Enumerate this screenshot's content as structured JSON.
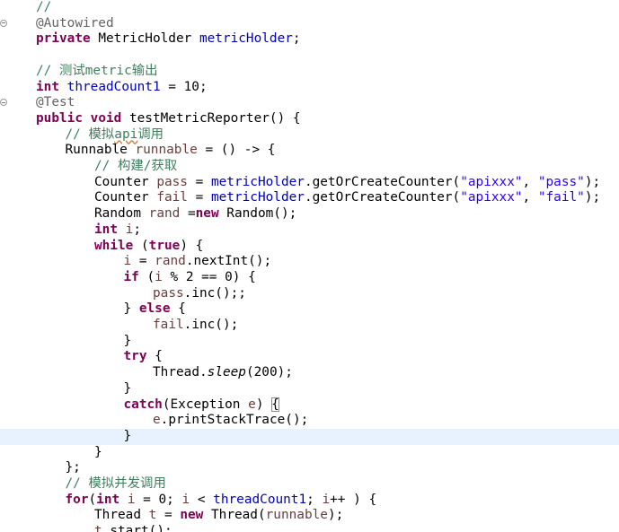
{
  "editor": {
    "lines": [
      {
        "indent": 0,
        "fold": false,
        "tokens": [
          {
            "t": "//",
            "k": "cm"
          }
        ]
      },
      {
        "indent": 0,
        "fold": true,
        "tokens": [
          {
            "t": "@Autowired",
            "k": "an"
          }
        ]
      },
      {
        "indent": 0,
        "fold": false,
        "tokens": [
          {
            "t": "private",
            "k": "kw"
          },
          {
            "t": " MetricHolder ",
            "k": "tx"
          },
          {
            "t": "metricHolder",
            "k": "fd"
          },
          {
            "t": ";",
            "k": "tx"
          }
        ]
      },
      {
        "indent": 0,
        "fold": false,
        "tokens": []
      },
      {
        "indent": 0,
        "fold": false,
        "tokens": [
          {
            "t": "// 测试metric输出",
            "k": "cm"
          }
        ]
      },
      {
        "indent": 0,
        "fold": false,
        "tokens": [
          {
            "t": "int",
            "k": "kw"
          },
          {
            "t": " ",
            "k": "tx"
          },
          {
            "t": "threadCount1",
            "k": "fd"
          },
          {
            "t": " = 10;",
            "k": "tx"
          }
        ]
      },
      {
        "indent": 0,
        "fold": true,
        "tokens": [
          {
            "t": "@Test",
            "k": "an"
          }
        ]
      },
      {
        "indent": 0,
        "fold": false,
        "tokens": [
          {
            "t": "public",
            "k": "kw"
          },
          {
            "t": " ",
            "k": "tx"
          },
          {
            "t": "void",
            "k": "kw"
          },
          {
            "t": " testMetricReporter() {",
            "k": "tx"
          }
        ]
      },
      {
        "indent": 1,
        "fold": false,
        "tokens": [
          {
            "t": "// 模拟",
            "k": "cm"
          },
          {
            "t": "api",
            "k": "cm",
            "sq": true
          },
          {
            "t": "调用",
            "k": "cm"
          }
        ]
      },
      {
        "indent": 1,
        "fold": false,
        "tokens": [
          {
            "t": "Runnable ",
            "k": "tx"
          },
          {
            "t": "runnable",
            "k": "lv"
          },
          {
            "t": " = () -> {",
            "k": "tx"
          }
        ]
      },
      {
        "indent": 2,
        "fold": false,
        "tokens": [
          {
            "t": "// 构建/获取",
            "k": "cm"
          }
        ]
      },
      {
        "indent": 2,
        "fold": false,
        "tokens": [
          {
            "t": "Counter ",
            "k": "tx"
          },
          {
            "t": "pass",
            "k": "lv"
          },
          {
            "t": " = ",
            "k": "tx"
          },
          {
            "t": "metricHolder",
            "k": "fd"
          },
          {
            "t": ".getOrCreateCounter(",
            "k": "tx"
          },
          {
            "t": "\"apixxx\"",
            "k": "st"
          },
          {
            "t": ", ",
            "k": "tx"
          },
          {
            "t": "\"pass\"",
            "k": "st"
          },
          {
            "t": ");",
            "k": "tx"
          }
        ]
      },
      {
        "indent": 2,
        "fold": false,
        "tokens": [
          {
            "t": "Counter ",
            "k": "tx"
          },
          {
            "t": "fail",
            "k": "lv"
          },
          {
            "t": " = ",
            "k": "tx"
          },
          {
            "t": "metricHolder",
            "k": "fd"
          },
          {
            "t": ".getOrCreateCounter(",
            "k": "tx"
          },
          {
            "t": "\"apixxx\"",
            "k": "st"
          },
          {
            "t": ", ",
            "k": "tx"
          },
          {
            "t": "\"fail\"",
            "k": "st"
          },
          {
            "t": ");",
            "k": "tx"
          }
        ]
      },
      {
        "indent": 2,
        "fold": false,
        "tokens": [
          {
            "t": "Random ",
            "k": "tx"
          },
          {
            "t": "rand",
            "k": "lv"
          },
          {
            "t": " =",
            "k": "tx"
          },
          {
            "t": "new",
            "k": "kw"
          },
          {
            "t": " Random();",
            "k": "tx"
          }
        ]
      },
      {
        "indent": 2,
        "fold": false,
        "tokens": [
          {
            "t": "int",
            "k": "kw"
          },
          {
            "t": " ",
            "k": "tx"
          },
          {
            "t": "i",
            "k": "lv"
          },
          {
            "t": ";",
            "k": "tx"
          }
        ]
      },
      {
        "indent": 2,
        "fold": false,
        "tokens": [
          {
            "t": "while",
            "k": "kw"
          },
          {
            "t": " (",
            "k": "tx"
          },
          {
            "t": "true",
            "k": "kw"
          },
          {
            "t": ") {",
            "k": "tx"
          }
        ]
      },
      {
        "indent": 3,
        "fold": false,
        "tokens": [
          {
            "t": "i",
            "k": "lv"
          },
          {
            "t": " = ",
            "k": "tx"
          },
          {
            "t": "rand",
            "k": "lv"
          },
          {
            "t": ".nextInt();",
            "k": "tx"
          }
        ]
      },
      {
        "indent": 3,
        "fold": false,
        "tokens": [
          {
            "t": "if",
            "k": "kw"
          },
          {
            "t": " (",
            "k": "tx"
          },
          {
            "t": "i",
            "k": "lv"
          },
          {
            "t": " % 2 == 0) {",
            "k": "tx"
          }
        ]
      },
      {
        "indent": 4,
        "fold": false,
        "tokens": [
          {
            "t": "pass",
            "k": "lv"
          },
          {
            "t": ".inc();;",
            "k": "tx"
          }
        ]
      },
      {
        "indent": 3,
        "fold": false,
        "tokens": [
          {
            "t": "} ",
            "k": "tx"
          },
          {
            "t": "else",
            "k": "kw"
          },
          {
            "t": " {",
            "k": "tx"
          }
        ]
      },
      {
        "indent": 4,
        "fold": false,
        "tokens": [
          {
            "t": "fail",
            "k": "lv"
          },
          {
            "t": ".inc();",
            "k": "tx"
          }
        ]
      },
      {
        "indent": 3,
        "fold": false,
        "tokens": [
          {
            "t": "}",
            "k": "tx"
          }
        ]
      },
      {
        "indent": 3,
        "fold": false,
        "tokens": [
          {
            "t": "try",
            "k": "kw"
          },
          {
            "t": " {",
            "k": "tx"
          }
        ]
      },
      {
        "indent": 4,
        "fold": false,
        "tokens": [
          {
            "t": "Thread.",
            "k": "tx"
          },
          {
            "t": "sleep",
            "k": "it"
          },
          {
            "t": "(200);",
            "k": "tx"
          }
        ]
      },
      {
        "indent": 3,
        "fold": false,
        "tokens": [
          {
            "t": "}",
            "k": "tx"
          }
        ]
      },
      {
        "indent": 3,
        "fold": false,
        "tokens": [
          {
            "t": "catch",
            "k": "kw"
          },
          {
            "t": "(Exception ",
            "k": "tx"
          },
          {
            "t": "e",
            "k": "lv"
          },
          {
            "t": ") ",
            "k": "tx"
          },
          {
            "t": "{",
            "k": "tx",
            "box": true
          }
        ]
      },
      {
        "indent": 4,
        "fold": false,
        "tokens": [
          {
            "t": "e",
            "k": "lv"
          },
          {
            "t": ".printStackTrace();",
            "k": "tx"
          }
        ]
      },
      {
        "indent": 3,
        "fold": false,
        "current": true,
        "tokens": [
          {
            "t": "}",
            "k": "tx"
          }
        ]
      },
      {
        "indent": 2,
        "fold": false,
        "tokens": [
          {
            "t": "}",
            "k": "tx"
          }
        ]
      },
      {
        "indent": 1,
        "fold": false,
        "tokens": [
          {
            "t": "};",
            "k": "tx"
          }
        ]
      },
      {
        "indent": 1,
        "fold": false,
        "tokens": [
          {
            "t": "// 模拟并发调用",
            "k": "cm"
          }
        ]
      },
      {
        "indent": 1,
        "fold": false,
        "tokens": [
          {
            "t": "for",
            "k": "kw"
          },
          {
            "t": "(",
            "k": "tx"
          },
          {
            "t": "int",
            "k": "kw"
          },
          {
            "t": " ",
            "k": "tx"
          },
          {
            "t": "i",
            "k": "lv"
          },
          {
            "t": " = 0; ",
            "k": "tx"
          },
          {
            "t": "i",
            "k": "lv"
          },
          {
            "t": " < ",
            "k": "tx"
          },
          {
            "t": "threadCount1",
            "k": "fd"
          },
          {
            "t": "; ",
            "k": "tx"
          },
          {
            "t": "i",
            "k": "lv"
          },
          {
            "t": "++ ) {",
            "k": "tx"
          }
        ]
      },
      {
        "indent": 2,
        "fold": false,
        "tokens": [
          {
            "t": "Thread ",
            "k": "tx"
          },
          {
            "t": "t",
            "k": "lv"
          },
          {
            "t": " = ",
            "k": "tx"
          },
          {
            "t": "new",
            "k": "kw"
          },
          {
            "t": " Thread(",
            "k": "tx"
          },
          {
            "t": "runnable",
            "k": "lv"
          },
          {
            "t": ");",
            "k": "tx"
          }
        ]
      },
      {
        "indent": 2,
        "fold": false,
        "tokens": [
          {
            "t": "t",
            "k": "lv"
          },
          {
            "t": ".start();",
            "k": "tx"
          }
        ]
      }
    ]
  }
}
